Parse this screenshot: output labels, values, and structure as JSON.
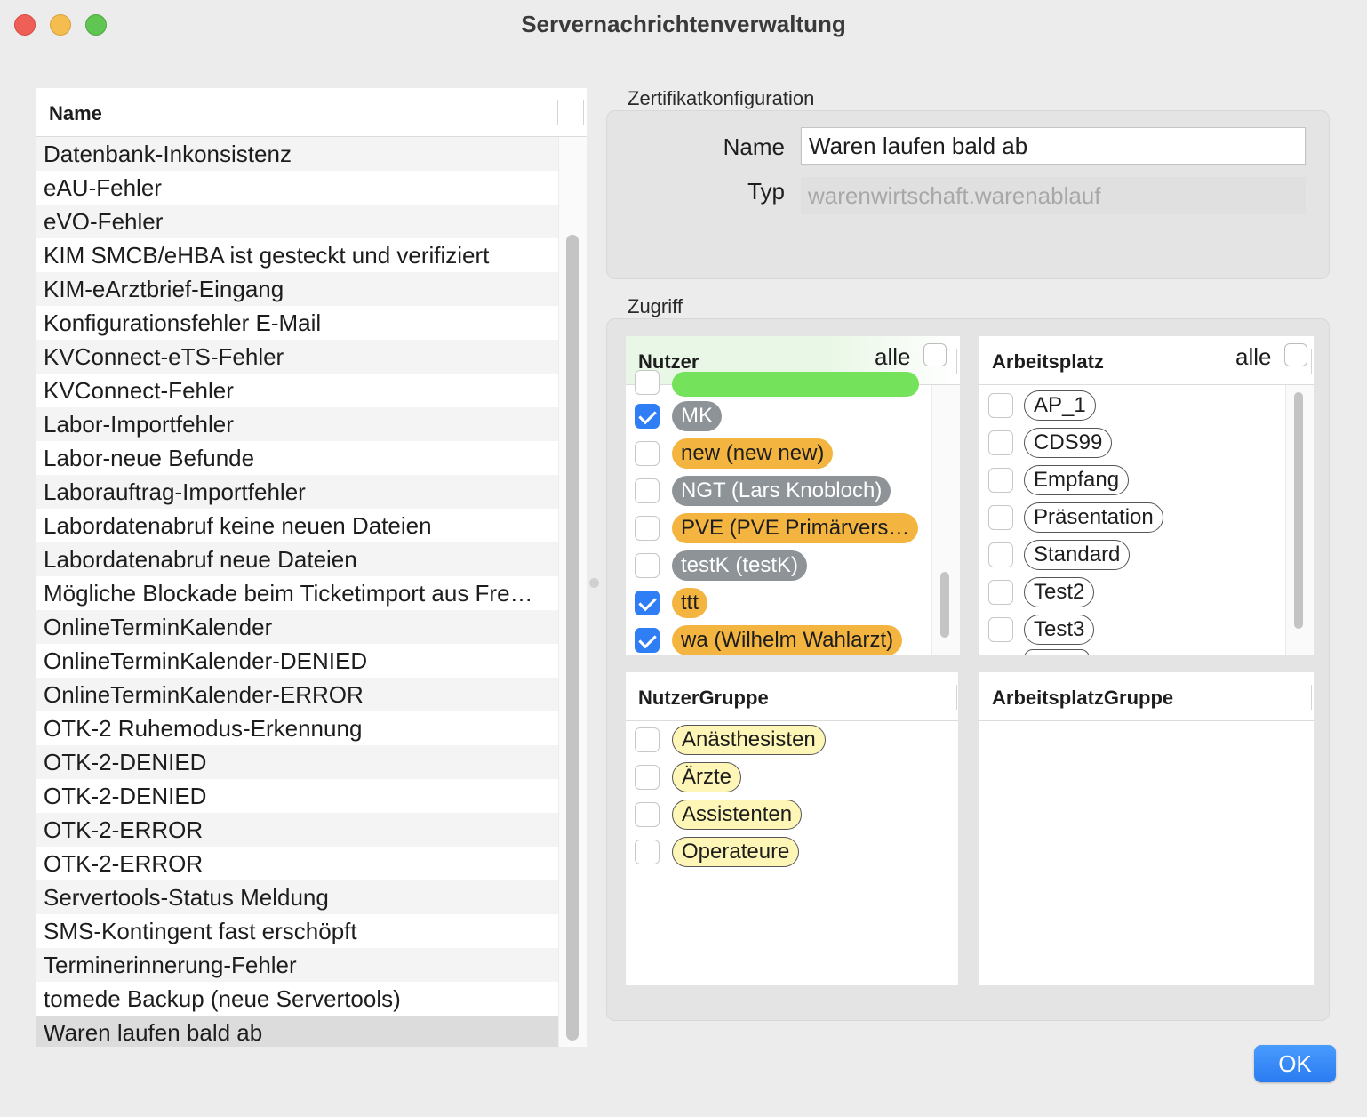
{
  "window": {
    "title": "Servernachrichtenverwaltung"
  },
  "list": {
    "header": "Name",
    "items": [
      "Datenbank-Inkonsistenz",
      "eAU-Fehler",
      "eVO-Fehler",
      "KIM SMCB/eHBA ist gesteckt und verifiziert",
      "KIM-eArztbrief-Eingang",
      "Konfigurationsfehler E-Mail",
      "KVConnect-eTS-Fehler",
      "KVConnect-Fehler",
      "Labor-Importfehler",
      "Labor-neue Befunde",
      "Laborauftrag-Importfehler",
      "Labordatenabruf keine neuen Dateien",
      "Labordatenabruf neue Dateien",
      "Mögliche Blockade beim Ticketimport aus Fre…",
      "OnlineTerminKalender",
      "OnlineTerminKalender-DENIED",
      "OnlineTerminKalender-ERROR",
      "OTK-2 Ruhemodus-Erkennung",
      "OTK-2-DENIED",
      "OTK-2-DENIED",
      "OTK-2-ERROR",
      "OTK-2-ERROR",
      "Servertools-Status Meldung",
      "SMS-Kontingent fast erschöpft",
      "Terminerinnerung-Fehler",
      "tomede Backup (neue Servertools)",
      "Waren laufen bald ab"
    ],
    "selected": "Waren laufen bald ab"
  },
  "cert": {
    "section": "Zertifikatkonfiguration",
    "name_label": "Name",
    "name_value": "Waren laufen bald ab",
    "type_label": "Typ",
    "type_value": "warenwirtschaft.warenablauf"
  },
  "access": {
    "section": "Zugriff",
    "nutzer": {
      "title": "Nutzer",
      "alle": "alle",
      "items": [
        {
          "label": "MK",
          "checked": true,
          "color": "gray"
        },
        {
          "label": "new (new new)",
          "checked": false,
          "color": "orange"
        },
        {
          "label": "NGT (Lars Knobloch)",
          "checked": false,
          "color": "gray"
        },
        {
          "label": "PVE (PVE Primärvers…",
          "checked": false,
          "color": "orange"
        },
        {
          "label": "testK (testK)",
          "checked": false,
          "color": "gray"
        },
        {
          "label": "ttt",
          "checked": true,
          "color": "orange"
        },
        {
          "label": "wa (Wilhelm Wahlarzt)",
          "checked": true,
          "color": "orange"
        }
      ]
    },
    "arbeitsplatz": {
      "title": "Arbeitsplatz",
      "alle": "alle",
      "items": [
        "AP_1",
        "CDS99",
        "Empfang",
        "Präsentation",
        "Standard",
        "Test2",
        "Test3"
      ]
    },
    "nutzergruppe": {
      "title": "NutzerGruppe",
      "items": [
        "Anästhesisten",
        "Ärzte",
        "Assistenten",
        "Operateure"
      ]
    },
    "arbeitsplatzgruppe": {
      "title": "ArbeitsplatzGruppe"
    }
  },
  "buttons": {
    "ok": "OK"
  },
  "colors": {
    "accent": "#2f7ef5",
    "orange_tag": "#f3b53f",
    "gray_tag": "#8e9397",
    "green_tag": "#74e35b",
    "group_tag": "#fdf6b6"
  }
}
